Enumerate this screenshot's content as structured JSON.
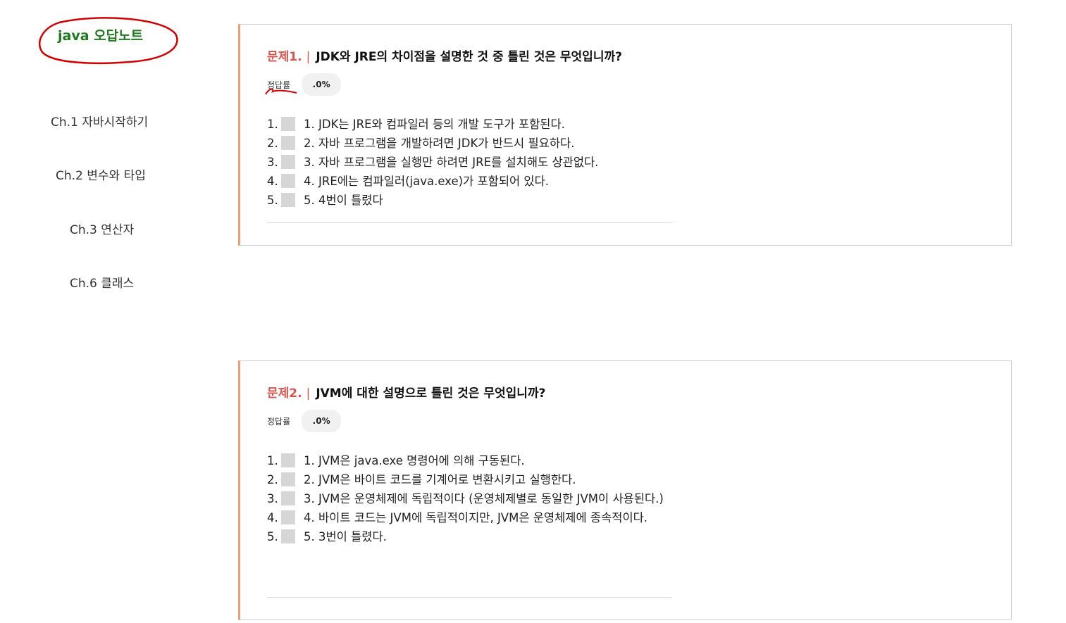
{
  "sidebar": {
    "logo": "java 오답노트",
    "items": [
      {
        "label": "Ch.1 자바시작하기"
      },
      {
        "label": "Ch.2 변수와 타입"
      },
      {
        "label": "Ch.3 연산자"
      },
      {
        "label": "Ch.6 클래스"
      }
    ]
  },
  "colors": {
    "accent_red": "#d9534f",
    "card_left_border": "#f0a070",
    "logo_green": "#1f7a1f",
    "logo_circle": "#d40000",
    "checkbox_gray": "#d6d6d6"
  },
  "questions": [
    {
      "number": "문제1.",
      "bar": "|",
      "title": "JDK와 JRE의 차이점을 설명한 것 중 틀린 것은 무엇입니까?",
      "rate_label": "정답률",
      "rate_value": ".0%",
      "options": [
        {
          "no": "1.",
          "text": "1. JDK는 JRE와 컴파일러 등의 개발 도구가 포함된다."
        },
        {
          "no": "2.",
          "text": "2. 자바 프로그램을 개발하려면 JDK가 반드시 필요하다."
        },
        {
          "no": "3.",
          "text": "3. 자바 프로그램을 실행만 하려면 JRE를 설치해도 상관없다."
        },
        {
          "no": "4.",
          "text": "4. JRE에는 컴파일러(java.exe)가 포함되어 있다."
        },
        {
          "no": "5.",
          "text": "5. 4번이 틀렸다"
        }
      ]
    },
    {
      "number": "문제2.",
      "bar": "|",
      "title": "JVM에 대한 설명으로 틀린 것은 무엇입니까?",
      "rate_label": "정답률",
      "rate_value": ".0%",
      "options": [
        {
          "no": "1.",
          "text": "1. JVM은 java.exe 명령어에 의해 구동된다."
        },
        {
          "no": "2.",
          "text": "2. JVM은 바이트 코드를 기계어로 변환시키고 실행한다."
        },
        {
          "no": "3.",
          "text": "3. JVM은 운영체제에 독립적이다 (운영체제별로 동일한 JVM이 사용된다.)"
        },
        {
          "no": "4.",
          "text": "4. 바이트 코드는 JVM에 독립적이지만, JVM은 운영체제에 종속적이다."
        },
        {
          "no": "5.",
          "text": "5. 3번이 틀렸다."
        }
      ]
    }
  ]
}
